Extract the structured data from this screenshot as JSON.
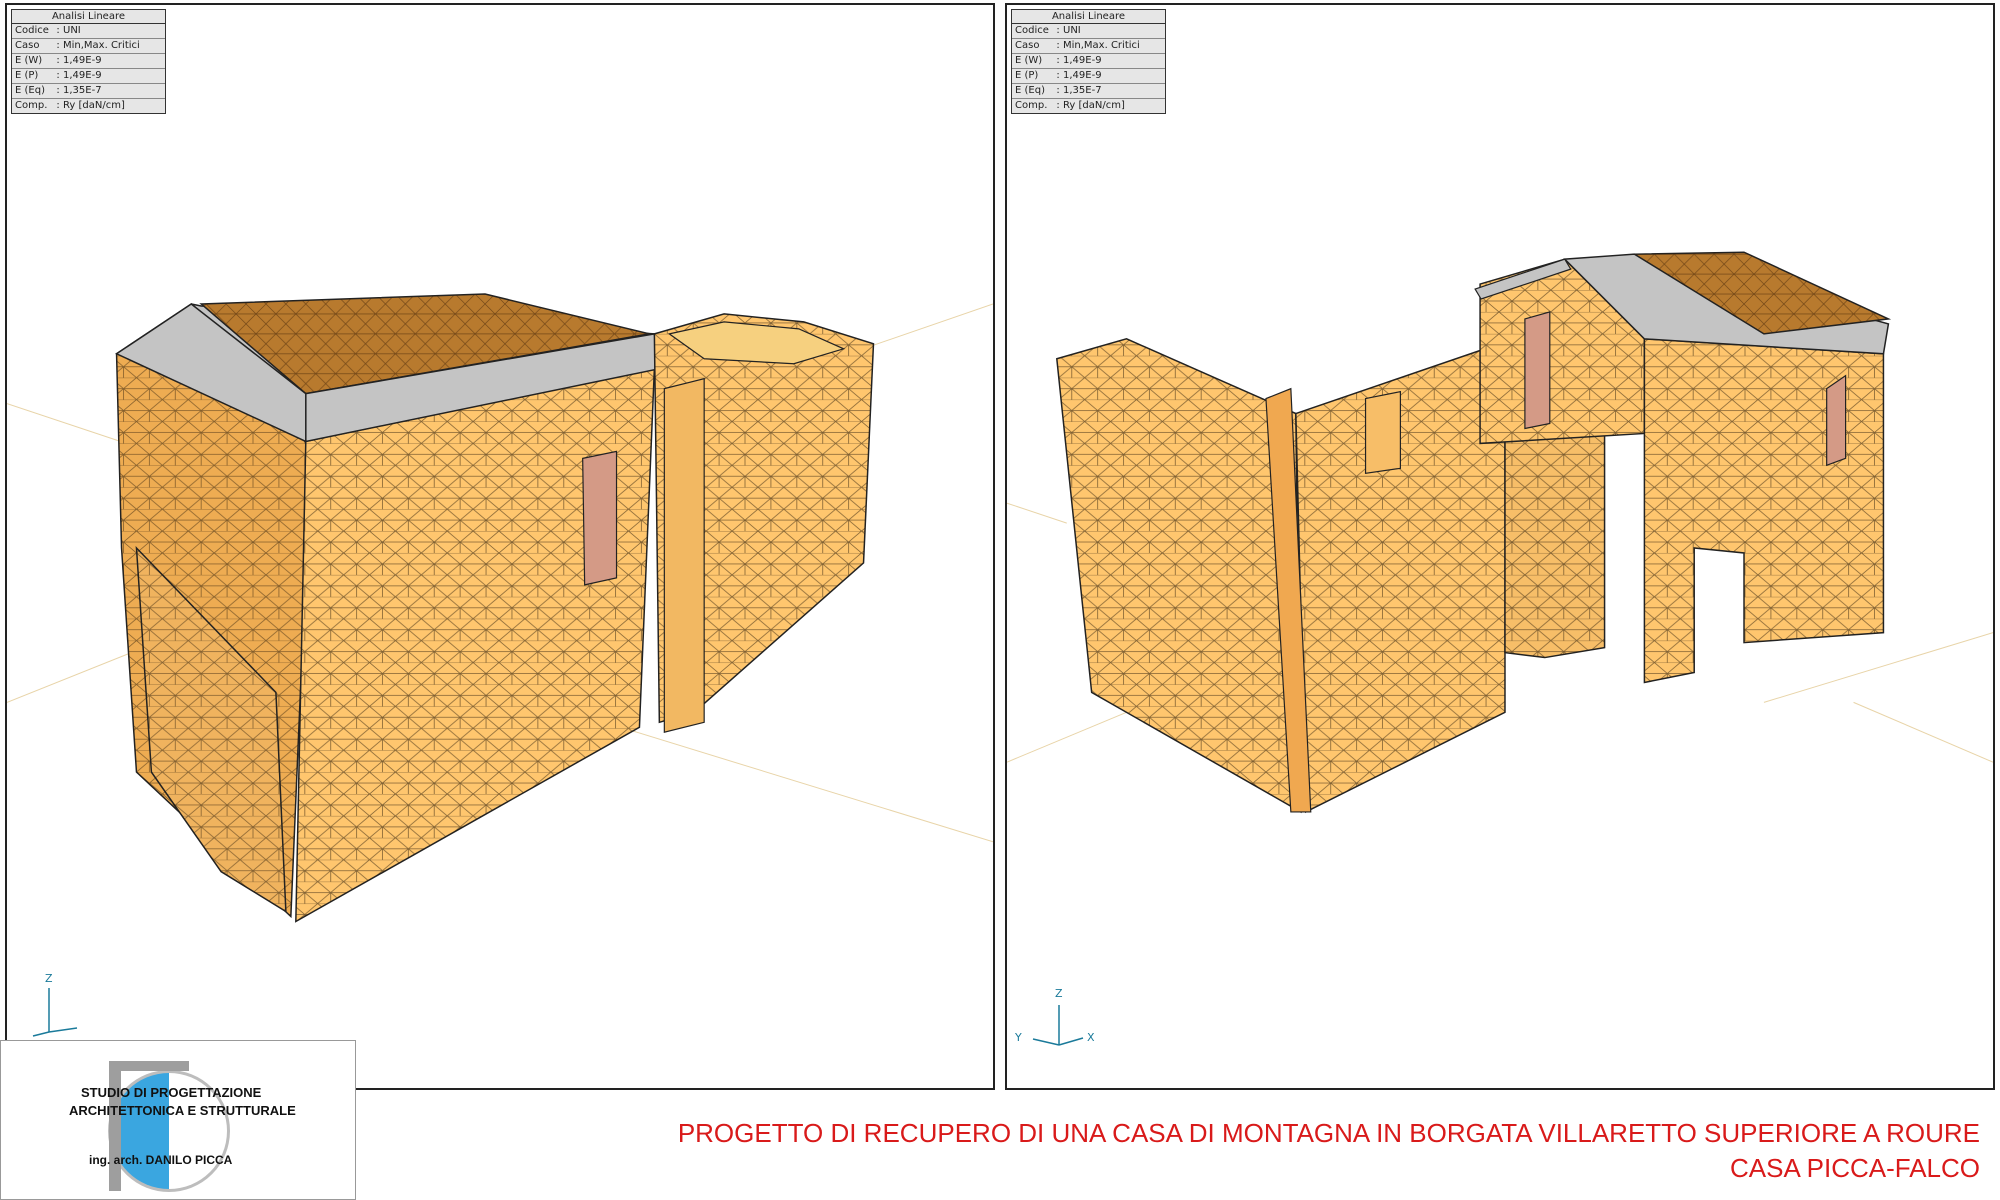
{
  "viewports": [
    {
      "legend": {
        "title": "Analisi Lineare",
        "rows": [
          {
            "key": "Codice",
            "value": "UNI"
          },
          {
            "key": "Caso",
            "value": "Min,Max. Critici"
          },
          {
            "key": "E (W)",
            "value": "1,49E-9"
          },
          {
            "key": "E (P)",
            "value": "1,49E-9"
          },
          {
            "key": "E (Eq)",
            "value": "1,35E-7"
          },
          {
            "key": "Comp.",
            "value": "Ry [daN/cm]"
          }
        ]
      },
      "axis": {
        "z": "Z"
      }
    },
    {
      "legend": {
        "title": "Analisi Lineare",
        "rows": [
          {
            "key": "Codice",
            "value": "UNI"
          },
          {
            "key": "Caso",
            "value": "Min,Max. Critici"
          },
          {
            "key": "E (W)",
            "value": "1,49E-9"
          },
          {
            "key": "E (P)",
            "value": "1,49E-9"
          },
          {
            "key": "E (Eq)",
            "value": "1,35E-7"
          },
          {
            "key": "Comp.",
            "value": "Ry [daN/cm]"
          }
        ]
      },
      "axis": {
        "z": "Z",
        "y": "Y",
        "x": "X"
      }
    }
  ],
  "logo": {
    "line1": "STUDIO DI PROGETTAZIONE",
    "line2": "ARCHITETTONICA E STRUTTURALE",
    "line3": "ing. arch. DANILO PICCA"
  },
  "caption": {
    "line1": "PROGETTO DI RECUPERO DI UNA CASA DI MONTAGNA IN BORGATA VILLARETTO SUPERIORE A ROURE",
    "line2": "CASA PICCA-FALCO"
  },
  "colors": {
    "wall": "#ffc66e",
    "wall_shade": "#eeac52",
    "roof": "#b87a2e",
    "roof_edge": "#c4c4c4",
    "opening": "#d49a86",
    "caption": "#d91a1a",
    "axis": "#1a7a9a"
  }
}
